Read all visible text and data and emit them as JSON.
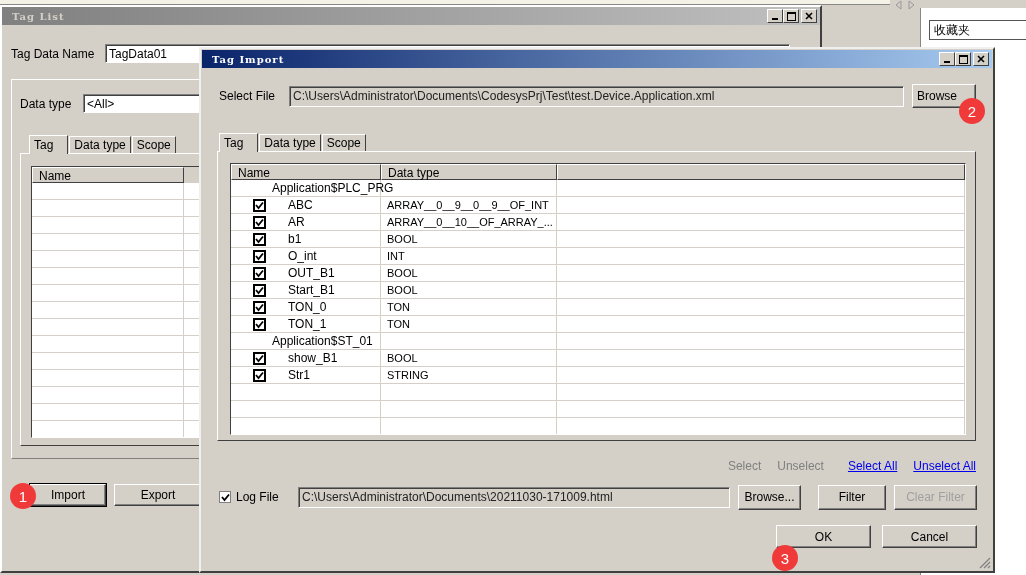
{
  "background": {
    "favorites_field": "收藏夹"
  },
  "tag_list": {
    "title": "Tag List",
    "tag_data_name_label": "Tag Data Name",
    "tag_data_name": "TagData01",
    "data_type_label": "Data type",
    "data_type": "<All>",
    "tabs": [
      {
        "label": "Tag",
        "selected": true
      },
      {
        "label": "Data type",
        "selected": false
      },
      {
        "label": "Scope",
        "selected": false
      }
    ],
    "columns": [
      "Name"
    ],
    "buttons": [
      {
        "label": "Import",
        "badge": "1"
      },
      {
        "label": "Export"
      }
    ]
  },
  "tag_import": {
    "title": "Tag Import",
    "select_file_label": "Select File",
    "file_path": "C:\\Users\\Administrator\\Documents\\CodesysPrj\\Test\\test.Device.Application.xml",
    "browse_button": {
      "label": "Browse",
      "badge": "2"
    },
    "tabs": [
      {
        "label": "Tag",
        "selected": true
      },
      {
        "label": "Data type",
        "selected": false
      },
      {
        "label": "Scope",
        "selected": false
      }
    ],
    "columns": [
      "Name",
      "Data type"
    ],
    "groups": [
      {
        "name": "Application$PLC_PRG",
        "children": [
          {
            "name": "ABC",
            "data_type": "ARRAY__0__9__0__9__OF_INT",
            "checked": true
          },
          {
            "name": "AR",
            "data_type": "ARRAY__0__10__OF_ARRAY_...",
            "checked": true
          },
          {
            "name": "b1",
            "data_type": "BOOL",
            "checked": true
          },
          {
            "name": "O_int",
            "data_type": "INT",
            "checked": true
          },
          {
            "name": "OUT_B1",
            "data_type": "BOOL",
            "checked": true
          },
          {
            "name": "Start_B1",
            "data_type": "BOOL",
            "checked": true
          },
          {
            "name": "TON_0",
            "data_type": "TON",
            "checked": true
          },
          {
            "name": "TON_1",
            "data_type": "TON",
            "checked": true
          }
        ]
      },
      {
        "name": "Application$ST_01",
        "children": [
          {
            "name": "show_B1",
            "data_type": "BOOL",
            "checked": true
          },
          {
            "name": "Str1",
            "data_type": "STRING",
            "checked": true
          }
        ]
      }
    ],
    "links": [
      {
        "label": "Select",
        "disabled": true
      },
      {
        "label": "Unselect",
        "disabled": true
      },
      {
        "label": "Select All",
        "disabled": false
      },
      {
        "label": "Unselect All",
        "disabled": false
      }
    ],
    "log_file": {
      "label": "Log File",
      "checked": true,
      "path": "C:\\Users\\Administrator\\Documents\\20211030-171009.html"
    },
    "buttons": [
      {
        "label": "Browse...",
        "disabled": false
      },
      {
        "label": "Filter",
        "disabled": false
      },
      {
        "label": "Clear Filter",
        "disabled": true
      }
    ],
    "dialog_buttons": [
      {
        "label": "OK",
        "badge": "3"
      },
      {
        "label": "Cancel"
      }
    ]
  }
}
